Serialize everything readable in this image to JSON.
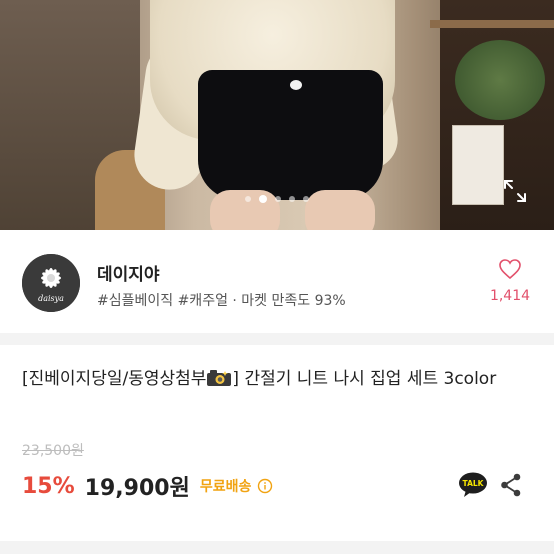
{
  "gallery": {
    "slide_count": 5,
    "active_slide": 2
  },
  "seller": {
    "name": "데이지야",
    "logo_text": "daisya",
    "tags": "#심플베이직 #캐주얼 · 마켓 만족도 93%",
    "like_count": "1,414"
  },
  "product": {
    "title_prefix": "[진베이지당일/동영상첨부",
    "title_suffix": "] 간절기 니트 나시 집업 세트 3color",
    "original_price": "23,500원",
    "discount": "15%",
    "price": "19,900원",
    "shipping": "무료배송"
  },
  "actions": {
    "talk_label": "TALK"
  },
  "colors": {
    "accent_red": "#e74b3c",
    "like_pink": "#e2506b",
    "shipping_orange": "#f1a311"
  },
  "icons": [
    "expand-icon",
    "heart-icon",
    "camera-emoji-icon",
    "info-icon",
    "kakaotalk-icon",
    "share-icon"
  ]
}
